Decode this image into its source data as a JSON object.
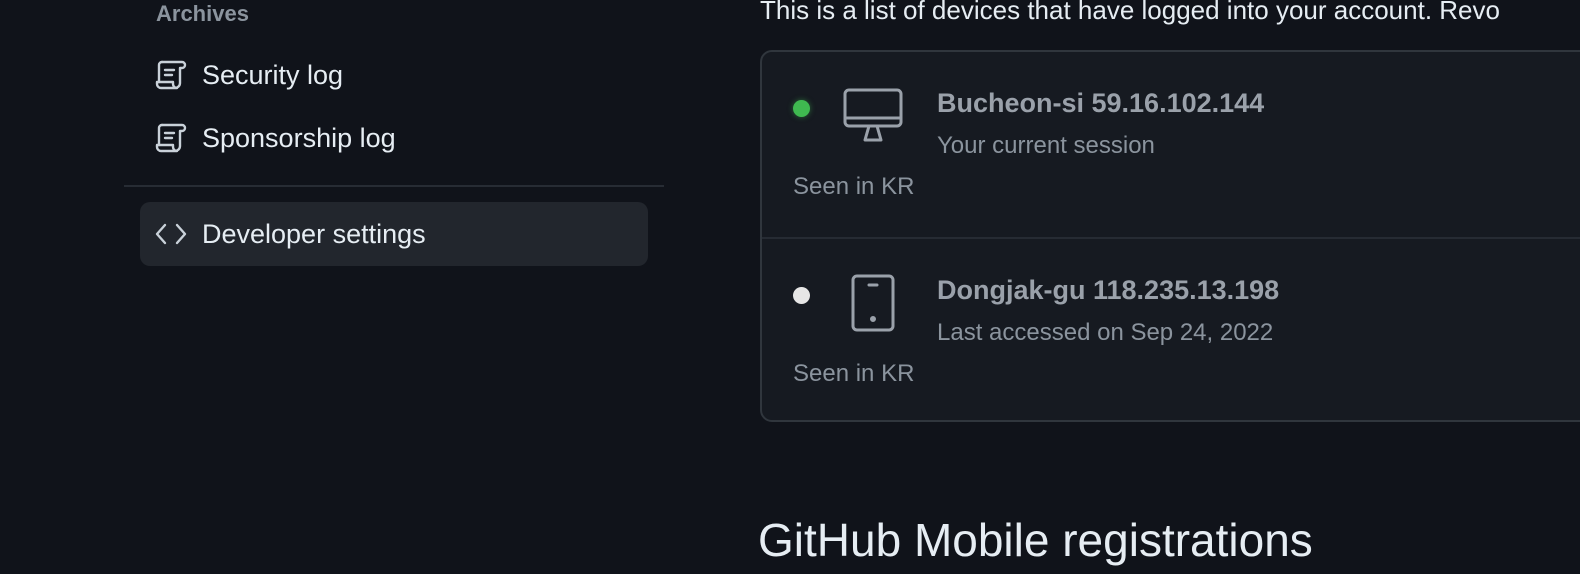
{
  "sidebar": {
    "section_heading": "Archives",
    "items": [
      {
        "label": "Security log",
        "icon": "log-icon"
      },
      {
        "label": "Sponsorship log",
        "icon": "log-icon"
      }
    ],
    "developer": {
      "label": "Developer settings",
      "icon": "code-icon"
    }
  },
  "main": {
    "intro": "This is a list of devices that have logged into your account. Revo",
    "sessions": [
      {
        "location_ip": "Bucheon-si 59.16.102.144",
        "detail": "Your current session",
        "seen": "Seen in KR",
        "status_color": "#3fb950",
        "device": "desktop-icon"
      },
      {
        "location_ip": "Dongjak-gu 118.235.13.198",
        "detail": "Last accessed on Sep 24, 2022",
        "seen": "Seen in KR",
        "status_color": "#e6e6e6",
        "device": "mobile-icon"
      }
    ],
    "mobile_heading": "GitHub Mobile registrations"
  },
  "colors": {
    "background": "#10131a",
    "active_status": "#3fb950",
    "inactive_status": "#e6e6e6"
  }
}
